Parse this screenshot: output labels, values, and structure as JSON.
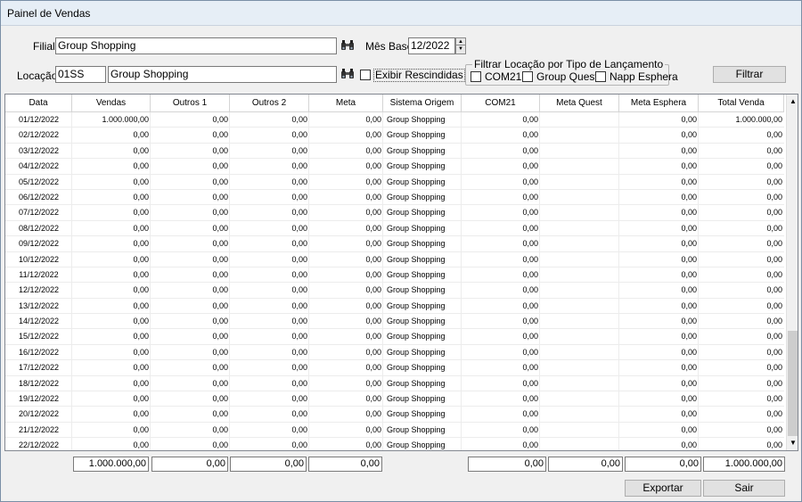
{
  "window": {
    "title": "Painel de Vendas"
  },
  "filters": {
    "filial_label": "Filial",
    "filial_value": "Group Shopping",
    "mes_base_label": "Mês Base",
    "mes_base_value": "12/2022",
    "locacao_label": "Locação",
    "locacao_code": "01SS",
    "locacao_name": "Group Shopping",
    "exibir_rescindidas_label": "Exibir Rescindidas",
    "exibir_rescindidas_checked": false,
    "tipo_group_title": "Filtrar Locação por Tipo de Lançamento",
    "tipo_options": [
      {
        "label": "COM21",
        "checked": false
      },
      {
        "label": "Group Quest",
        "checked": false
      },
      {
        "label": "Napp Esphera",
        "checked": false
      }
    ],
    "filtrar_label": "Filtrar"
  },
  "grid": {
    "columns": [
      "Data",
      "Vendas",
      "Outros 1",
      "Outros 2",
      "Meta",
      "Sistema Origem",
      "COM21",
      "Meta Quest",
      "Meta Esphera",
      "Total Venda"
    ],
    "rows": [
      [
        "01/12/2022",
        "1.000.000,00",
        "0,00",
        "0,00",
        "0,00",
        "Group Shopping",
        "0,00",
        "",
        "0,00",
        "1.000.000,00"
      ],
      [
        "02/12/2022",
        "0,00",
        "0,00",
        "0,00",
        "0,00",
        "Group Shopping",
        "0,00",
        "",
        "0,00",
        "0,00"
      ],
      [
        "03/12/2022",
        "0,00",
        "0,00",
        "0,00",
        "0,00",
        "Group Shopping",
        "0,00",
        "",
        "0,00",
        "0,00"
      ],
      [
        "04/12/2022",
        "0,00",
        "0,00",
        "0,00",
        "0,00",
        "Group Shopping",
        "0,00",
        "",
        "0,00",
        "0,00"
      ],
      [
        "05/12/2022",
        "0,00",
        "0,00",
        "0,00",
        "0,00",
        "Group Shopping",
        "0,00",
        "",
        "0,00",
        "0,00"
      ],
      [
        "06/12/2022",
        "0,00",
        "0,00",
        "0,00",
        "0,00",
        "Group Shopping",
        "0,00",
        "",
        "0,00",
        "0,00"
      ],
      [
        "07/12/2022",
        "0,00",
        "0,00",
        "0,00",
        "0,00",
        "Group Shopping",
        "0,00",
        "",
        "0,00",
        "0,00"
      ],
      [
        "08/12/2022",
        "0,00",
        "0,00",
        "0,00",
        "0,00",
        "Group Shopping",
        "0,00",
        "",
        "0,00",
        "0,00"
      ],
      [
        "09/12/2022",
        "0,00",
        "0,00",
        "0,00",
        "0,00",
        "Group Shopping",
        "0,00",
        "",
        "0,00",
        "0,00"
      ],
      [
        "10/12/2022",
        "0,00",
        "0,00",
        "0,00",
        "0,00",
        "Group Shopping",
        "0,00",
        "",
        "0,00",
        "0,00"
      ],
      [
        "11/12/2022",
        "0,00",
        "0,00",
        "0,00",
        "0,00",
        "Group Shopping",
        "0,00",
        "",
        "0,00",
        "0,00"
      ],
      [
        "12/12/2022",
        "0,00",
        "0,00",
        "0,00",
        "0,00",
        "Group Shopping",
        "0,00",
        "",
        "0,00",
        "0,00"
      ],
      [
        "13/12/2022",
        "0,00",
        "0,00",
        "0,00",
        "0,00",
        "Group Shopping",
        "0,00",
        "",
        "0,00",
        "0,00"
      ],
      [
        "14/12/2022",
        "0,00",
        "0,00",
        "0,00",
        "0,00",
        "Group Shopping",
        "0,00",
        "",
        "0,00",
        "0,00"
      ],
      [
        "15/12/2022",
        "0,00",
        "0,00",
        "0,00",
        "0,00",
        "Group Shopping",
        "0,00",
        "",
        "0,00",
        "0,00"
      ],
      [
        "16/12/2022",
        "0,00",
        "0,00",
        "0,00",
        "0,00",
        "Group Shopping",
        "0,00",
        "",
        "0,00",
        "0,00"
      ],
      [
        "17/12/2022",
        "0,00",
        "0,00",
        "0,00",
        "0,00",
        "Group Shopping",
        "0,00",
        "",
        "0,00",
        "0,00"
      ],
      [
        "18/12/2022",
        "0,00",
        "0,00",
        "0,00",
        "0,00",
        "Group Shopping",
        "0,00",
        "",
        "0,00",
        "0,00"
      ],
      [
        "19/12/2022",
        "0,00",
        "0,00",
        "0,00",
        "0,00",
        "Group Shopping",
        "0,00",
        "",
        "0,00",
        "0,00"
      ],
      [
        "20/12/2022",
        "0,00",
        "0,00",
        "0,00",
        "0,00",
        "Group Shopping",
        "0,00",
        "",
        "0,00",
        "0,00"
      ],
      [
        "21/12/2022",
        "0,00",
        "0,00",
        "0,00",
        "0,00",
        "Group Shopping",
        "0,00",
        "",
        "0,00",
        "0,00"
      ],
      [
        "22/12/2022",
        "0,00",
        "0,00",
        "0,00",
        "0,00",
        "Group Shopping",
        "0,00",
        "",
        "0,00",
        "0,00"
      ]
    ]
  },
  "totals": {
    "vendas": "1.000.000,00",
    "outros1": "0,00",
    "outros2": "0,00",
    "meta": "0,00",
    "com21": "0,00",
    "meta_quest": "0,00",
    "meta_esphera": "0,00",
    "total_venda": "1.000.000,00"
  },
  "actions": {
    "exportar_label": "Exportar",
    "sair_label": "Sair"
  },
  "icons": {
    "search": "binoculars-icon",
    "spin_up": "arrow-up-icon",
    "spin_down": "arrow-down-icon",
    "scroll_up": "scroll-up-icon",
    "scroll_down": "scroll-down-icon"
  }
}
